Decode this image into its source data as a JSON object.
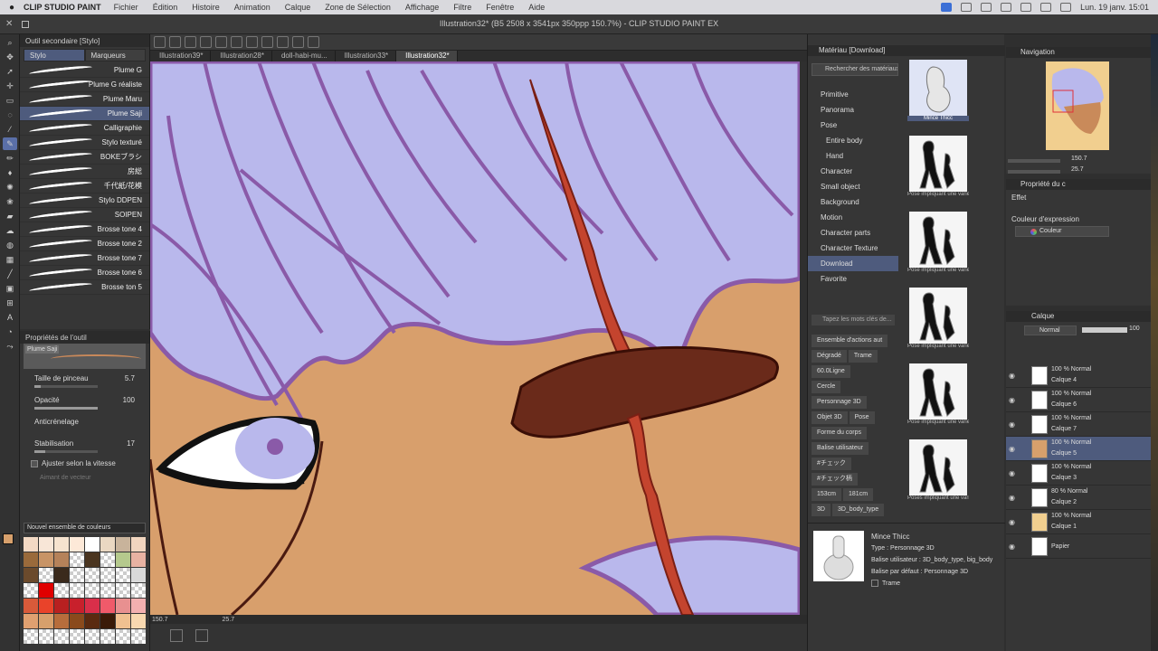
{
  "menubar": {
    "apple": "",
    "app_name": "CLIP STUDIO PAINT",
    "items": [
      "Fichier",
      "Édition",
      "Histoire",
      "Animation",
      "Calque",
      "Zone de Sélection",
      "Affichage",
      "Filtre",
      "Fenêtre",
      "Aide"
    ],
    "clock": "Lun. 19 janv.  15:01"
  },
  "window": {
    "title": "Illustration32* (B5 2508 x 3541px 350ppp 150.7%) - CLIP STUDIO PAINT EX"
  },
  "doc_tabs": [
    "Illustration39*",
    "Illustration28*",
    "doll-habi-mu...",
    "Illustration33*",
    "Illustration32*"
  ],
  "doc_tabs_active": 4,
  "subtool": {
    "header": "Outil secondaire [Stylo]",
    "tabs": [
      "Stylo",
      "Marqueurs"
    ],
    "brushes": [
      "Plume G",
      "Plume G réaliste",
      "Plume Maru",
      "Plume Saji",
      "Calligraphie",
      "Stylo texturé",
      "BOKEブラシ",
      "房総",
      "千代紙/花模",
      "Stylo DDPEN",
      "SOIPEN",
      "Brosse tone 4",
      "Brosse tone 2",
      "Brosse tone 7",
      "Brosse tone 6",
      "Brosse ton 5"
    ],
    "active_index": 3
  },
  "toolprop": {
    "header": "Propriétés de l'outil",
    "preview_label": "Plume Saji",
    "brush_size_label": "Taille de pinceau",
    "brush_size": "5.7",
    "opacity_label": "Opacité",
    "opacity": "100",
    "antialias_label": "Anticrénelage",
    "stabilization_label": "Stabilisation",
    "stabilization": "17",
    "speed_label": "Ajuster selon la vitesse",
    "vector_label": "Aimant de vecteur"
  },
  "colorset": {
    "name": "Nouvel ensemble de couleurs",
    "swatches": [
      "#f3d9c4",
      "#f8e6d7",
      "#f6e3cf",
      "#fde9d8",
      "#ffffff",
      "#ead8c2",
      "#c8b39b",
      "#f1d5bf",
      "#9a6a3b",
      "#c89466",
      "#b5825a",
      "transparent",
      "#4a3520",
      "transparent",
      "#b5c98d",
      "#e8b2a2",
      "#6b4a2c",
      "transparent",
      "#3a2a1c",
      "transparent",
      "transparent",
      "transparent",
      "transparent",
      "#d9d9d9",
      "transparent",
      "#e00000",
      "transparent",
      "transparent",
      "transparent",
      "transparent",
      "transparent",
      "transparent",
      "#d85a3a",
      "#e9432a",
      "#b82020",
      "#c8202c",
      "#d92f4a",
      "#f05a6a",
      "#e89090",
      "#f3b0b0",
      "#e0a070",
      "#d7a06c",
      "#b76d3c",
      "#8a4a1c",
      "#5a2a10",
      "#3a1a08",
      "#f0c090",
      "#f8d8b0",
      "transparent",
      "transparent",
      "transparent",
      "transparent",
      "transparent",
      "transparent",
      "transparent",
      "transparent"
    ],
    "fg_color": "#d7a06c",
    "bg_color": "#ffffff"
  },
  "canvas": {
    "zoom": "150.7",
    "angle": "25.7"
  },
  "materials": {
    "header": "Matériau [Download]",
    "search_placeholder": "Rechercher des matériaux su",
    "tree": [
      {
        "label": "Primitive",
        "sub": false
      },
      {
        "label": "Panorama",
        "sub": false
      },
      {
        "label": "Pose",
        "sub": false
      },
      {
        "label": "Entire body",
        "sub": true
      },
      {
        "label": "Hand",
        "sub": true
      },
      {
        "label": "Character",
        "sub": false
      },
      {
        "label": "Small object",
        "sub": false
      },
      {
        "label": "Background",
        "sub": false
      },
      {
        "label": "Motion",
        "sub": false
      },
      {
        "label": "Character parts",
        "sub": false
      },
      {
        "label": "Character Texture",
        "sub": false
      },
      {
        "label": "Download",
        "sub": false
      },
      {
        "label": "Favorite",
        "sub": false
      }
    ],
    "tree_active": 11,
    "tag_search_placeholder": "Tapez les mots clés de...",
    "tags": [
      [
        "Ensemble d'actions aut"
      ],
      [
        "Dégradé",
        "Trame"
      ],
      [
        "60.0Ligne"
      ],
      [
        "Cercle"
      ],
      [
        "Personnage 3D"
      ],
      [
        "Objet 3D",
        "Pose"
      ],
      [
        "Forme du corps"
      ],
      [
        "Balise utilisateur"
      ],
      [
        "#チェック"
      ],
      [
        "#チェック柄"
      ],
      [
        "153cm",
        "181cm"
      ],
      [
        "3D",
        "3D_body_type"
      ]
    ],
    "thumbs": [
      "Mince Thicc",
      "Pose impliquant une variét",
      "Pose impliquant une variét",
      "Pose impliquant une variét",
      "Pose impliquant une variét",
      "Poses impliquant une variét"
    ],
    "detail": {
      "name": "Mince Thicc",
      "type": "Type : Personnage 3D",
      "user_tag": "Balise utilisateur : 3D_body_type, big_body",
      "default_tag": "Balise par défaut : Personnage 3D",
      "trame": "Trame"
    }
  },
  "navigation": {
    "header": "Navigation",
    "zoom": "150.7",
    "angle": "25.7"
  },
  "properties": {
    "header": "Propriété du c",
    "effect": "Effet",
    "expression_color": "Couleur d'expression",
    "color_mode": "Couleur"
  },
  "layers": {
    "header": "Calque",
    "blend": "Normal",
    "opacity": "100",
    "items": [
      {
        "mode": "100 % Normal",
        "name": "Calque 4",
        "visible": true,
        "thumb": "#ffffff"
      },
      {
        "mode": "100 % Normal",
        "name": "Calque 6",
        "visible": true,
        "thumb": "#ffffff"
      },
      {
        "mode": "100 % Normal",
        "name": "Calque 7",
        "visible": true,
        "thumb": "#ffffff"
      },
      {
        "mode": "100 % Normal",
        "name": "Calque 5",
        "visible": true,
        "thumb": "#d7a06c"
      },
      {
        "mode": "100 % Normal",
        "name": "Calque 3",
        "visible": true,
        "thumb": "#ffffff"
      },
      {
        "mode": "80 % Normal",
        "name": "Calque 2",
        "visible": true,
        "thumb": "#ffffff"
      },
      {
        "mode": "100 % Normal",
        "name": "Calque 1",
        "visible": true,
        "thumb": "#f1cf8f"
      },
      {
        "mode": "",
        "name": "Papier",
        "visible": true,
        "thumb": "#ffffff"
      }
    ],
    "active_index": 3
  },
  "colors": {
    "skin": "#d89f6c",
    "hair": "#b9b8ec",
    "hair_line": "#8a5aa8",
    "blood": "#c4442e",
    "shadow_brow": "#6a2a1a",
    "accent": "#4e5b7d"
  }
}
